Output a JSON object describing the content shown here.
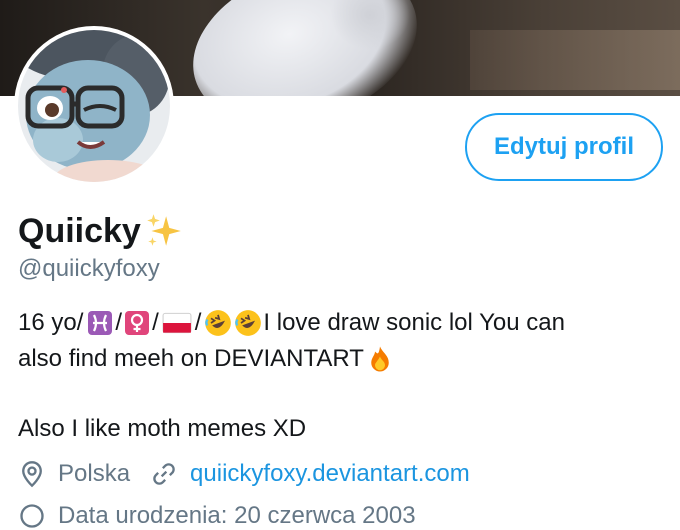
{
  "profile": {
    "name": "Quiicky",
    "handle": "@quiickyfoxy",
    "edit_button": "Edytuj profil",
    "bio_line1_prefix": "16 yo/",
    "bio_line1_suffix": "I love draw sonic lol You can",
    "bio_line2": "also find meeh on DEVIANTART",
    "bio_line3": "Also I like moth memes XD",
    "location": "Polska",
    "website": "quiickyfoxy.deviantart.com",
    "cutoff_text": "Data urodzenia: 20 czerwca 2003"
  },
  "icons": [
    "sparkles-icon",
    "pisces-icon",
    "female-sign-icon",
    "poland-flag-icon",
    "rofl-emoji-icon",
    "fire-icon",
    "location-pin-icon",
    "link-icon",
    "calendar-icon"
  ],
  "colors": {
    "accent": "#1da1f2",
    "link": "#1b95e0",
    "muted": "#657786",
    "text": "#14171a"
  }
}
